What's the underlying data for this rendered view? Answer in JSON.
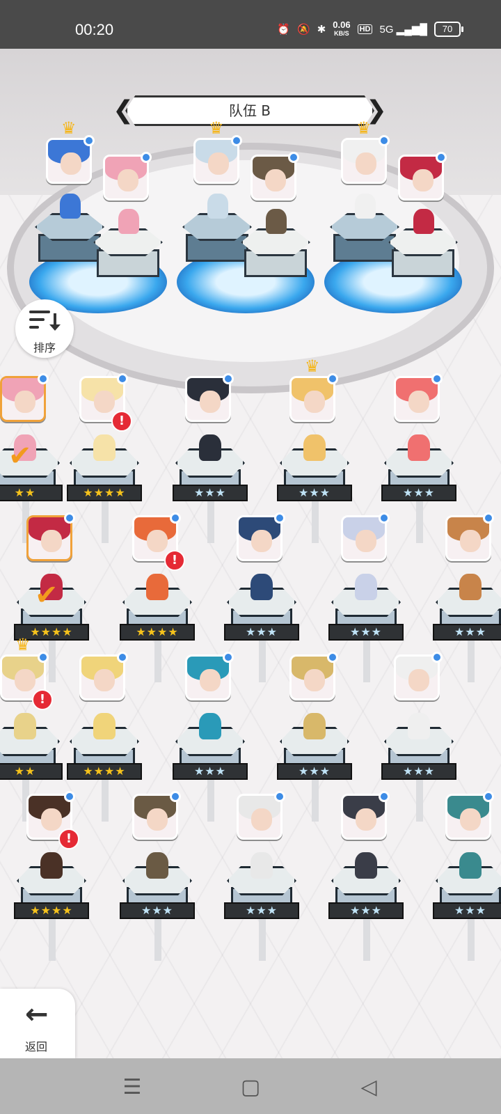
{
  "status_bar": {
    "time": "00:20",
    "net_speed_value": "0.06",
    "net_speed_unit": "KB/S",
    "hd": "HD",
    "signal": "5G",
    "battery": "70"
  },
  "team": {
    "title": "队伍 B",
    "prev_icon": "chevron-left-icon",
    "next_icon": "chevron-right-icon"
  },
  "sort_button": {
    "label": "排序",
    "icon": "sort-descending-icon"
  },
  "back_button": {
    "label": "返回",
    "icon": "arrow-left-icon"
  },
  "team_slots": [
    {
      "leader": true,
      "hair": "#3c77d6",
      "stars": null
    },
    {
      "leader": false,
      "hair": "#f0a3b6",
      "stars": null
    },
    {
      "leader": true,
      "hair": "#c9dbe8",
      "stars": null
    },
    {
      "leader": false,
      "hair": "#6b5a46",
      "stars": null
    },
    {
      "leader": true,
      "hair": "#f0f0f0",
      "stars": null
    },
    {
      "leader": false,
      "hair": "#c32a44",
      "stars": null
    }
  ],
  "heroes": [
    {
      "row": 0,
      "col": 0,
      "stars": "★★",
      "gold": true,
      "hair": "#f0a3b6",
      "selected": true,
      "alert": false
    },
    {
      "row": 0,
      "col": 1,
      "stars": "★★★★",
      "gold": true,
      "hair": "#f6e2a8",
      "selected": false,
      "alert": true
    },
    {
      "row": 0,
      "col": 2,
      "stars": "★★★",
      "gold": false,
      "hair": "#2a2f3a",
      "selected": false,
      "alert": false
    },
    {
      "row": 0,
      "col": 3,
      "stars": "★★★",
      "gold": false,
      "hair": "#f0c26a",
      "selected": false,
      "alert": false,
      "leader": true
    },
    {
      "row": 0,
      "col": 4,
      "stars": "★★★",
      "gold": false,
      "hair": "#f07070",
      "selected": false,
      "alert": false
    },
    {
      "row": 1,
      "col": 0,
      "stars": "★★★★",
      "gold": true,
      "hair": "#c32a44",
      "selected": true,
      "alert": false
    },
    {
      "row": 1,
      "col": 1,
      "stars": "★★★★",
      "gold": true,
      "hair": "#e86a3a",
      "selected": false,
      "alert": true
    },
    {
      "row": 1,
      "col": 2,
      "stars": "★★★",
      "gold": false,
      "hair": "#2d4a78",
      "selected": false,
      "alert": false
    },
    {
      "row": 1,
      "col": 3,
      "stars": "★★★",
      "gold": false,
      "hair": "#c9d1e8",
      "selected": false,
      "alert": false
    },
    {
      "row": 1,
      "col": 4,
      "stars": "★★★",
      "gold": false,
      "hair": "#c8844a",
      "selected": false,
      "alert": false
    },
    {
      "row": 2,
      "col": 0,
      "stars": "★★",
      "gold": true,
      "hair": "#e8d28a",
      "selected": false,
      "alert": true,
      "leader": true
    },
    {
      "row": 2,
      "col": 1,
      "stars": "★★★★",
      "gold": true,
      "hair": "#f0d47a",
      "selected": false,
      "alert": false
    },
    {
      "row": 2,
      "col": 2,
      "stars": "★★★",
      "gold": false,
      "hair": "#2a9ab8",
      "selected": false,
      "alert": false
    },
    {
      "row": 2,
      "col": 3,
      "stars": "★★★",
      "gold": false,
      "hair": "#d8b86a",
      "selected": false,
      "alert": false
    },
    {
      "row": 2,
      "col": 4,
      "stars": "★★★",
      "gold": false,
      "hair": "#efefef",
      "selected": false,
      "alert": false
    },
    {
      "row": 3,
      "col": 0,
      "stars": "★★★★",
      "gold": true,
      "hair": "#4a3126",
      "selected": false,
      "alert": true
    },
    {
      "row": 3,
      "col": 1,
      "stars": "★★★",
      "gold": false,
      "hair": "#6a5a44",
      "selected": false,
      "alert": false
    },
    {
      "row": 3,
      "col": 2,
      "stars": "★★★",
      "gold": false,
      "hair": "#e8e8e8",
      "selected": false,
      "alert": false
    },
    {
      "row": 3,
      "col": 3,
      "stars": "★★★",
      "gold": false,
      "hair": "#3a3d48",
      "selected": false,
      "alert": false
    },
    {
      "row": 3,
      "col": 4,
      "stars": "★★★",
      "gold": false,
      "hair": "#3a8a8e",
      "selected": false,
      "alert": false
    }
  ],
  "colors": {
    "accent": "#f0a23a",
    "alert": "#e52a35",
    "indicator": "#3d8ce6"
  }
}
